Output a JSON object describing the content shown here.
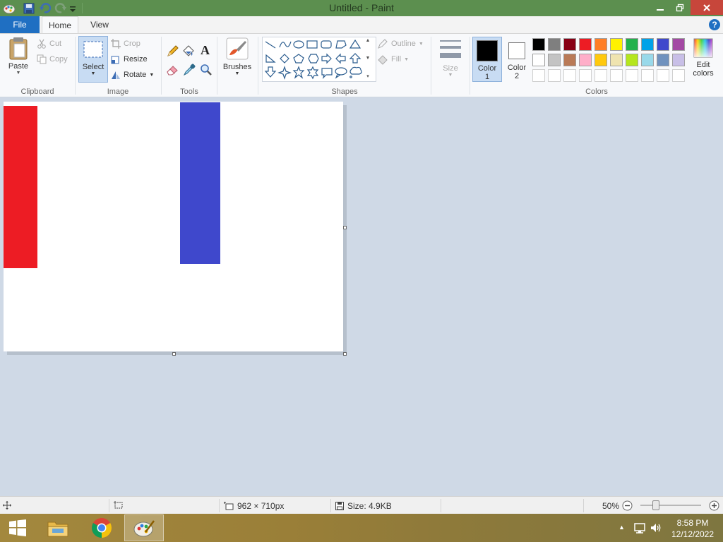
{
  "window": {
    "title": "Untitled - Paint"
  },
  "tabs": {
    "file": "File",
    "home": "Home",
    "view": "View"
  },
  "clipboard": {
    "paste": "Paste",
    "cut": "Cut",
    "copy": "Copy",
    "group_label": "Clipboard"
  },
  "image": {
    "select": "Select",
    "crop": "Crop",
    "resize": "Resize",
    "rotate": "Rotate",
    "group_label": "Image"
  },
  "tools": {
    "group_label": "Tools",
    "text_glyph": "A"
  },
  "brushes": {
    "label": "Brushes"
  },
  "shapes": {
    "outline": "Outline",
    "fill": "Fill",
    "group_label": "Shapes"
  },
  "size": {
    "label": "Size"
  },
  "colors": {
    "color1_label": "Color",
    "color1_num": "1",
    "color2_label": "Color",
    "color2_num": "2",
    "color1_value": "#000000",
    "color2_value": "#ffffff",
    "edit_label_1": "Edit",
    "edit_label_2": "colors",
    "group_label": "Colors",
    "palette_row1": [
      "#000000",
      "#7f7f7f",
      "#880015",
      "#ed1c24",
      "#ff7f27",
      "#fff200",
      "#22b14c",
      "#00a2e8",
      "#3f48cc",
      "#a349a4"
    ],
    "palette_row2": [
      "#ffffff",
      "#c3c3c3",
      "#b97a57",
      "#ffaec9",
      "#ffc90e",
      "#efe4b0",
      "#b5e61d",
      "#99d9ea",
      "#7092be",
      "#c8bfe7"
    ]
  },
  "canvas_shapes": {
    "red_fill": "#ed1c24",
    "blue_fill": "#3f48cc"
  },
  "status": {
    "dimensions": "962 × 710px",
    "size": "Size: 4.9KB",
    "zoom": "50%"
  },
  "taskbar": {
    "time": "8:58 PM",
    "date": "12/12/2022"
  }
}
